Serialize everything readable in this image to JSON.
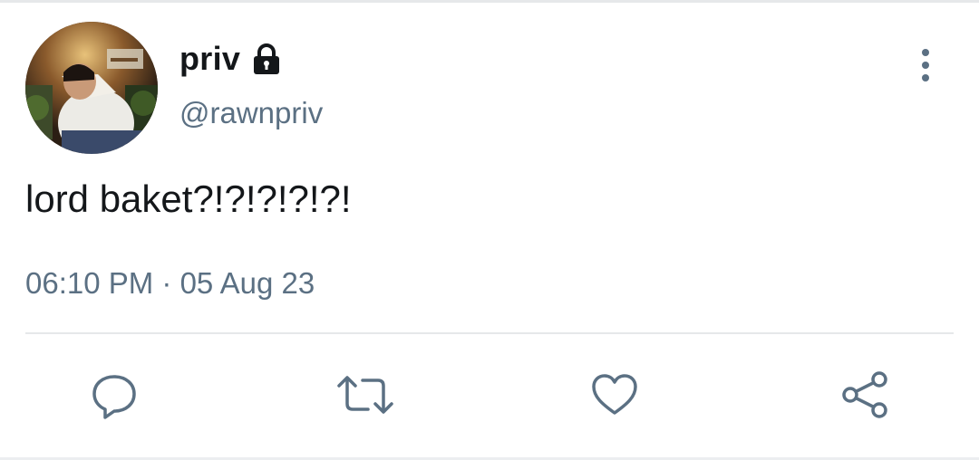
{
  "tweet": {
    "author": {
      "display_name": "priv",
      "handle": "@rawnpriv",
      "protected_icon": "lock-icon",
      "avatar": "profile-photo"
    },
    "text": "lord baket?!?!?!?!?!",
    "timestamp": "06:10 PM · 05 Aug 23"
  },
  "menu": {
    "icon": "more-vertical-icon"
  },
  "actions": [
    {
      "name": "reply",
      "icon": "comment-icon"
    },
    {
      "name": "retweet",
      "icon": "retweet-icon"
    },
    {
      "name": "like",
      "icon": "heart-icon"
    },
    {
      "name": "share",
      "icon": "share-icon"
    }
  ],
  "colors": {
    "primary_text": "#14171a",
    "secondary_text": "#5b7083",
    "divider": "#e6e8ea"
  }
}
